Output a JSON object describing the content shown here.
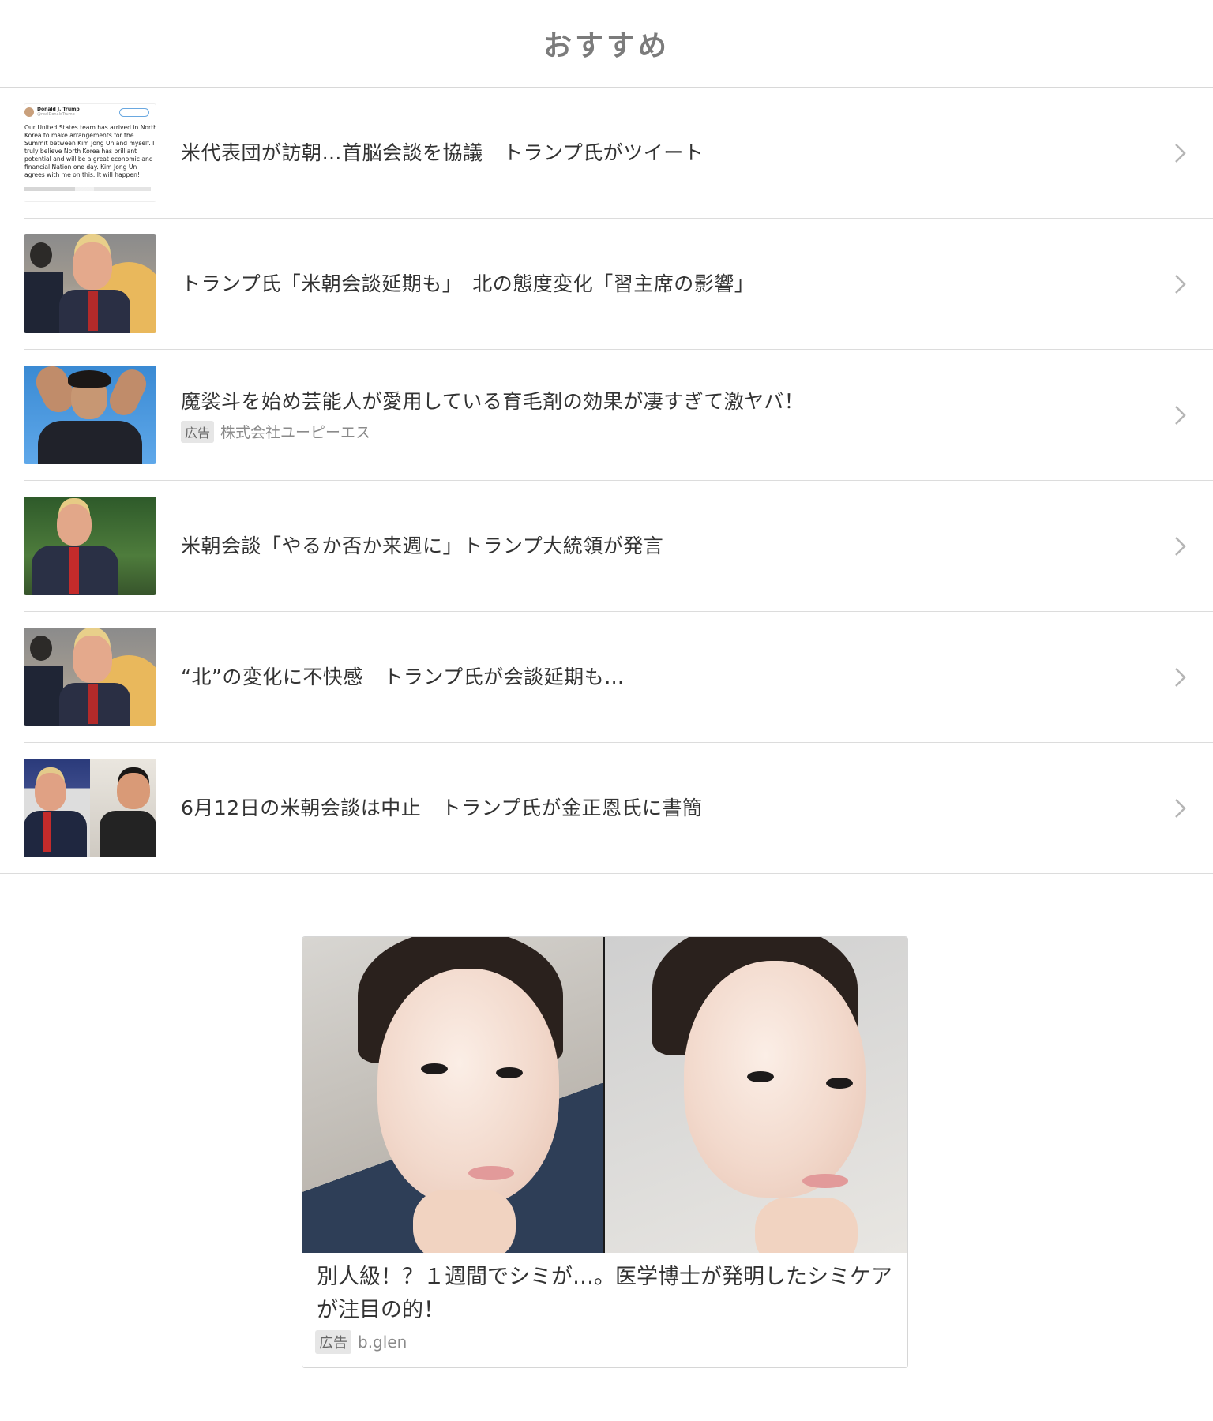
{
  "header": {
    "title": "おすすめ"
  },
  "items": [
    {
      "title": "米代表団が訪朝…首脳会談を協議　トランプ氏がツイート",
      "thumb": {
        "name": "Donald J. Trump",
        "handle": "@realDonaldTrump",
        "tweet": "Our United States team has arrived in North Korea to make arrangements for the Summit between Kim Jong Un and myself. I truly believe North Korea has brilliant potential and will be a great economic and financial Nation one day. Kim Jong Un agrees with me on this. It will happen!"
      }
    },
    {
      "title": "トランプ氏「米朝会談延期も」　北の態度変化「習主席の影響」"
    },
    {
      "title": "魔裟斗を始め芸能人が愛用している育毛剤の効果が凄すぎて激ヤバ！",
      "ad_label": "広告",
      "sponsor": "株式会社ユーピーエス"
    },
    {
      "title": "米朝会談「やるか否か来週に」トランプ大統領が発言"
    },
    {
      "title": "“北”の変化に不快感　トランプ氏が会談延期も…"
    },
    {
      "title": "6月12日の米朝会談は中止　トランプ氏が金正恩氏に書簡"
    }
  ],
  "ad_card": {
    "title": "別人級！？１週間でシミが…。医学博士が発明したシミケアが注目の的！",
    "ad_label": "広告",
    "sponsor": "b.glen"
  },
  "icons": {
    "row_chevron": "chevron-right-icon"
  },
  "colors": {
    "header_text": "#7b7b7b",
    "divider": "#d8d8d8",
    "title_text": "#333333",
    "chevron": "#b5b5b5"
  }
}
